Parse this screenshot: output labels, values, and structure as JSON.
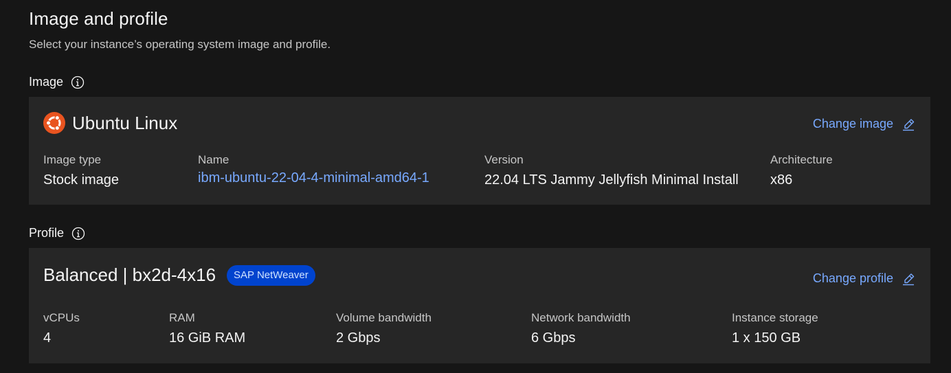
{
  "section": {
    "title": "Image and profile",
    "subtitle": "Select your instance’s operating system image and profile."
  },
  "image": {
    "label": "Image",
    "os_name": "Ubuntu Linux",
    "change_label": "Change image",
    "fields": [
      {
        "label": "Image type",
        "value": "Stock image"
      },
      {
        "label": "Name",
        "value": "ibm-ubuntu-22-04-4-minimal-amd64-1"
      },
      {
        "label": "Version",
        "value": "22.04 LTS Jammy Jellyfish Minimal Install"
      },
      {
        "label": "Architecture",
        "value": "x86"
      }
    ]
  },
  "profile": {
    "label": "Profile",
    "name": "Balanced | bx2d-4x16",
    "tag": "SAP NetWeaver",
    "change_label": "Change profile",
    "fields": [
      {
        "label": "vCPUs",
        "value": "4"
      },
      {
        "label": "RAM",
        "value": "16 GiB RAM"
      },
      {
        "label": "Volume bandwidth",
        "value": "2 Gbps"
      },
      {
        "label": "Network bandwidth",
        "value": "6 Gbps"
      },
      {
        "label": "Instance storage",
        "value": "1 x 150 GB"
      }
    ]
  },
  "icons": {
    "info": "information-icon",
    "edit": "edit-pencil-icon",
    "os": "ubuntu-logo-icon"
  },
  "colors": {
    "background": "#161616",
    "tile": "#262626",
    "link": "#78a9ff",
    "tag_bg": "#0043ce",
    "ubuntu_orange": "#e95420"
  }
}
